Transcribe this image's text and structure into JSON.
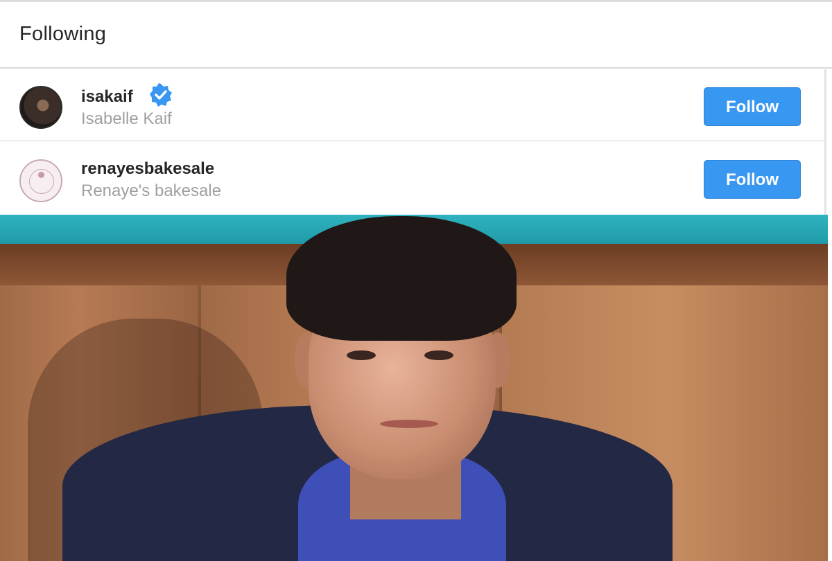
{
  "header": {
    "title": "Following"
  },
  "users": [
    {
      "username": "isakaif",
      "full_name": "Isabelle Kaif",
      "verified": true,
      "button_label": "Follow"
    },
    {
      "username": "renayesbakesale",
      "full_name": "Renaye's bakesale",
      "verified": false,
      "button_label": "Follow"
    }
  ],
  "colors": {
    "follow_button": "#3897f0",
    "verified_badge": "#3897f0"
  },
  "icons": {
    "verified": "verified-badge-icon"
  }
}
